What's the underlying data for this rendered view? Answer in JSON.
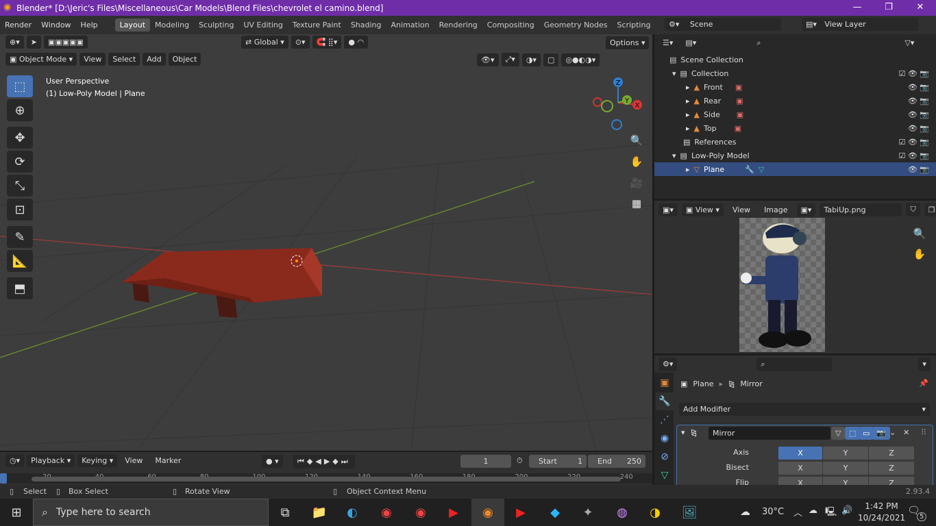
{
  "window": {
    "title": "Blender* [D:\\Jeric's Files\\Miscellaneous\\Car Models\\Blend Files\\chevrolet el camino.blend]",
    "minimize": "—",
    "maximize": "❐",
    "close": "✕"
  },
  "menu": [
    "Render",
    "Window",
    "Help"
  ],
  "workspaces": [
    "Layout",
    "Modeling",
    "Sculpting",
    "UV Editing",
    "Texture Paint",
    "Shading",
    "Animation",
    "Rendering",
    "Compositing",
    "Geometry Nodes",
    "Scripting"
  ],
  "scene": {
    "scene_label": "Scene",
    "view_layer": "View Layer"
  },
  "viewport": {
    "transform_orientation": "Global",
    "options": "Options",
    "mode": "Object Mode",
    "menus": [
      "View",
      "Select",
      "Add",
      "Object"
    ],
    "overlay_title": "User Perspective",
    "overlay_subtitle": "(1) Low-Poly Model | Plane",
    "gizmo": {
      "x": "X",
      "y": "Y",
      "z": "Z"
    },
    "colors": {
      "x_axis": "#a33a3a",
      "y_axis": "#6b8f2a",
      "object": "#8a2a1c"
    }
  },
  "outliner": {
    "rows": [
      {
        "label": "Scene Collection",
        "level": 0
      },
      {
        "label": "Collection",
        "level": 1
      },
      {
        "label": "Front",
        "level": 2
      },
      {
        "label": "Rear",
        "level": 2
      },
      {
        "label": "Side",
        "level": 2
      },
      {
        "label": "Top",
        "level": 2
      },
      {
        "label": "References",
        "level": 1
      },
      {
        "label": "Low-Poly Model",
        "level": 1
      },
      {
        "label": "Plane",
        "level": 2,
        "selected": true
      }
    ]
  },
  "image_editor": {
    "view_mode": "View",
    "menus": [
      "View",
      "Image"
    ],
    "image_name": "TabiUp.png"
  },
  "properties": {
    "breadcrumb_object": "Plane",
    "breadcrumb_modifier": "Mirror",
    "add_modifier": "Add Modifier",
    "modifier_name": "Mirror",
    "rows": [
      {
        "label": "Axis",
        "values": [
          "X",
          "Y",
          "Z"
        ],
        "active": "X"
      },
      {
        "label": "Bisect",
        "values": [
          "X",
          "Y",
          "Z"
        ]
      },
      {
        "label": "Flip",
        "values": [
          "X",
          "Y",
          "Z"
        ]
      }
    ]
  },
  "timeline": {
    "menus": [
      "Playback",
      "Keying",
      "View",
      "Marker"
    ],
    "current_frame": "1",
    "start_label": "Start",
    "start": "1",
    "end_label": "End",
    "end": "250",
    "ticks": [
      "20",
      "40",
      "60",
      "80",
      "100",
      "120",
      "140",
      "160",
      "180",
      "200",
      "220",
      "240"
    ]
  },
  "status": {
    "select": "Select",
    "box_select": "Box Select",
    "rotate_view": "Rotate View",
    "context_menu": "Object Context Menu",
    "version": "2.93.4"
  },
  "taskbar": {
    "search_placeholder": "Type here to search",
    "weather": "30°C",
    "time": "1:42 PM",
    "date": "10/24/2021",
    "notifications": "5"
  }
}
